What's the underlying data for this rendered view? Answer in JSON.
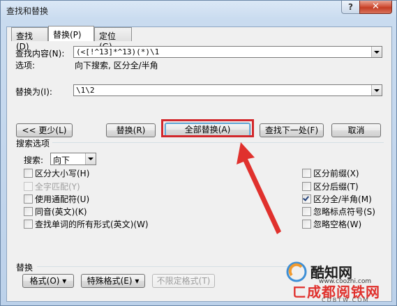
{
  "window": {
    "title": "查找和替换",
    "help": "?",
    "close": "✕"
  },
  "tabs": [
    {
      "label": "查找(D)"
    },
    {
      "label": "替换(P)"
    },
    {
      "label": "定位(G)"
    }
  ],
  "find": {
    "label": "查找内容(N):",
    "value": "(<[!^13]*^13)(*)\\1"
  },
  "options": {
    "label": "选项:",
    "value": "向下搜索, 区分全/半角"
  },
  "replace": {
    "label": "替换为(I):",
    "value": "\\1\\2"
  },
  "buttons": {
    "less": "<< 更少(L)",
    "replace": "替换(R)",
    "replace_all": "全部替换(A)",
    "find_next": "查找下一处(F)",
    "cancel": "取消"
  },
  "search_options": {
    "title": "搜索选项",
    "search_label": "搜索:",
    "search_value": "向下",
    "left": [
      {
        "label": "区分大小写(H)",
        "checked": false,
        "disabled": false
      },
      {
        "label": "全字匹配(Y)",
        "checked": false,
        "disabled": true
      },
      {
        "label": "使用通配符(U)",
        "checked": false,
        "disabled": false
      },
      {
        "label": "同音(英文)(K)",
        "checked": false,
        "disabled": false
      },
      {
        "label": "查找单词的所有形式(英文)(W)",
        "checked": false,
        "disabled": false
      }
    ],
    "right": [
      {
        "label": "区分前缀(X)",
        "checked": false,
        "disabled": false
      },
      {
        "label": "区分后缀(T)",
        "checked": false,
        "disabled": false
      },
      {
        "label": "区分全/半角(M)",
        "checked": true,
        "disabled": false
      },
      {
        "label": "忽略标点符号(S)",
        "checked": false,
        "disabled": false
      },
      {
        "label": "忽略空格(W)",
        "checked": false,
        "disabled": false
      }
    ]
  },
  "replace_section": {
    "title": "替换",
    "format": "格式(O) ▾",
    "special": "特殊格式(E) ▾",
    "no_format": "不限定格式(T)"
  },
  "watermark": {
    "brand": "酷知网",
    "url": "www.coozhi.com",
    "brand2": "ㄈ成都阅铁网",
    "url2": "CDBTW.COM"
  },
  "colors": {
    "highlight": "#d2272b",
    "arrow": "#e0312d"
  }
}
